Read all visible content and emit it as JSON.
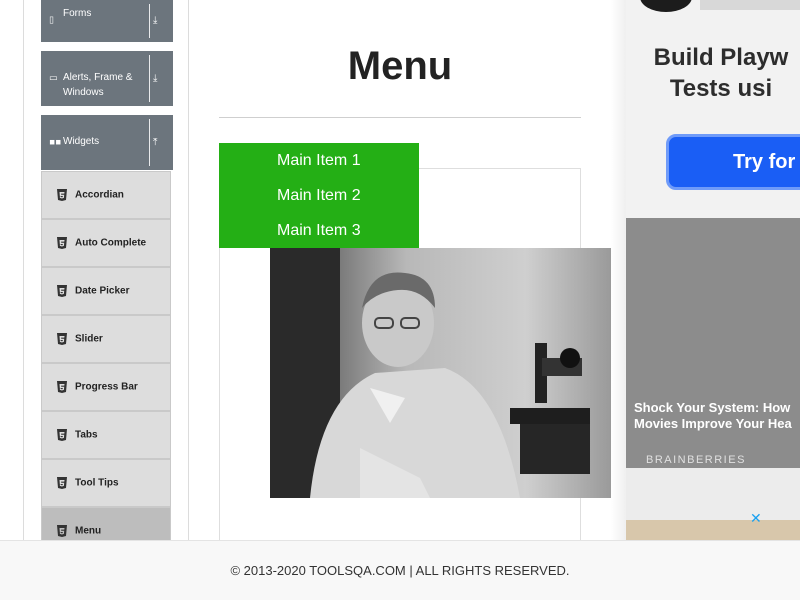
{
  "sidebar": {
    "groups": [
      {
        "label": "Forms",
        "icon": "file-icon",
        "arrow": "⤓"
      },
      {
        "label": "Alerts, Frame & Windows",
        "icon": "window-icon",
        "arrow": "⤓"
      },
      {
        "label": "Widgets",
        "icon": "grid-icon",
        "arrow": "⤒"
      }
    ],
    "items": [
      {
        "label": "Accordian"
      },
      {
        "label": "Auto Complete"
      },
      {
        "label": "Date Picker"
      },
      {
        "label": "Slider"
      },
      {
        "label": "Progress Bar"
      },
      {
        "label": "Tabs"
      },
      {
        "label": "Tool Tips"
      },
      {
        "label": "Menu"
      }
    ],
    "active_item": "Menu"
  },
  "main": {
    "title": "Menu",
    "menu_items": [
      "Main Item 1",
      "Main Item 2",
      "Main Item 3"
    ],
    "menu_color": "#24af15"
  },
  "ad": {
    "headline": "Build Playw\nTests usi",
    "cta": "Try for fre",
    "caption": "Shock Your System: How\nMovies Improve Your Hea",
    "brand": "BRAINBERRIES",
    "close": "✕",
    "cta_color": "#1a5ef5"
  },
  "footer": {
    "text": "© 2013-2020 TOOLSQA.COM | ALL RIGHTS RESERVED."
  }
}
